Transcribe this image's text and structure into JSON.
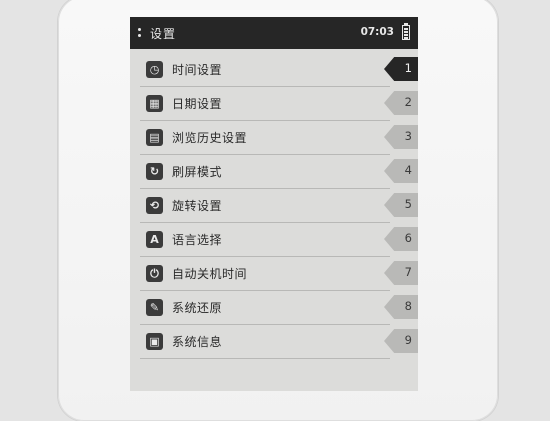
{
  "statusbar": {
    "title": "设置",
    "time": "07:03"
  },
  "menu": {
    "items": [
      {
        "label": "时间设置",
        "number": "1",
        "icon": "clock-settings-icon",
        "glyph": "◷",
        "active": true
      },
      {
        "label": "日期设置",
        "number": "2",
        "icon": "calendar-settings-icon",
        "glyph": "▦",
        "active": false
      },
      {
        "label": "浏览历史设置",
        "number": "3",
        "icon": "history-settings-icon",
        "glyph": "▤",
        "active": false
      },
      {
        "label": "刷屏模式",
        "number": "4",
        "icon": "refresh-mode-icon",
        "glyph": "↻",
        "active": false
      },
      {
        "label": "旋转设置",
        "number": "5",
        "icon": "rotate-settings-icon",
        "glyph": "⟲",
        "active": false
      },
      {
        "label": "语言选择",
        "number": "6",
        "icon": "language-icon",
        "glyph": "A",
        "active": false
      },
      {
        "label": "自动关机时间",
        "number": "7",
        "icon": "auto-shutdown-icon",
        "glyph": "⏻",
        "active": false
      },
      {
        "label": "系统还原",
        "number": "8",
        "icon": "system-restore-icon",
        "glyph": "✎",
        "active": false
      },
      {
        "label": "系统信息",
        "number": "9",
        "icon": "system-info-icon",
        "glyph": "▣",
        "active": false
      }
    ]
  },
  "colors": {
    "statusbar_bg": "#262626",
    "screen_bg": "#dcdcda",
    "tab_active": "#262626",
    "tab_inactive": "#b9b9b7"
  }
}
